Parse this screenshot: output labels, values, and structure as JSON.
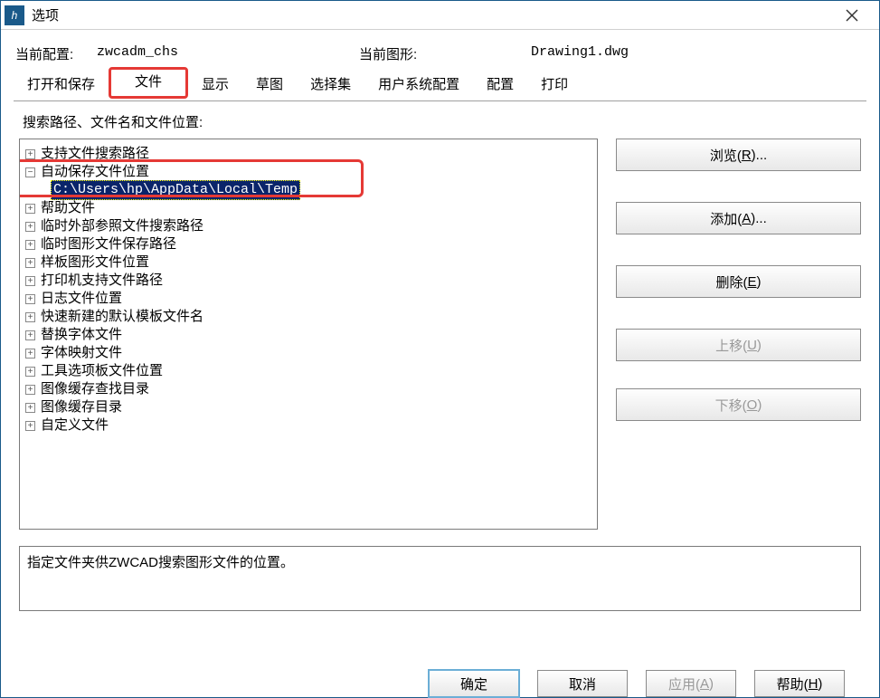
{
  "window_title": "选项",
  "config": {
    "profile_label": "当前配置:",
    "profile_value": "zwcadm_chs",
    "drawing_label": "当前图形:",
    "drawing_value": "Drawing1.dwg"
  },
  "tabs": [
    {
      "label": "打开和保存"
    },
    {
      "label": "文件",
      "active": true,
      "highlighted": true
    },
    {
      "label": "显示"
    },
    {
      "label": "草图"
    },
    {
      "label": "选择集"
    },
    {
      "label": "用户系统配置"
    },
    {
      "label": "配置"
    },
    {
      "label": "打印"
    }
  ],
  "section_heading": "搜索路径、文件名和文件位置:",
  "tree": {
    "items": [
      {
        "expander": "plus",
        "label": "支持文件搜索路径"
      },
      {
        "expander": "minus",
        "label": "自动保存文件位置",
        "highlighted": true
      },
      {
        "indent": true,
        "selected_path": "C:\\Users\\hp\\AppData\\Local\\Temp"
      },
      {
        "expander": "plus",
        "label": "帮助文件"
      },
      {
        "expander": "plus",
        "label": "临时外部参照文件搜索路径"
      },
      {
        "expander": "plus",
        "label": "临时图形文件保存路径"
      },
      {
        "expander": "plus",
        "label": "样板图形文件位置"
      },
      {
        "expander": "plus",
        "label": "打印机支持文件路径"
      },
      {
        "expander": "plus",
        "label": "日志文件位置"
      },
      {
        "expander": "plus",
        "label": "快速新建的默认模板文件名"
      },
      {
        "expander": "plus",
        "label": "替换字体文件"
      },
      {
        "expander": "plus",
        "label": "字体映射文件"
      },
      {
        "expander": "plus",
        "label": "工具选项板文件位置"
      },
      {
        "expander": "plus",
        "label": "图像缓存查找目录"
      },
      {
        "expander": "plus",
        "label": "图像缓存目录"
      },
      {
        "expander": "plus",
        "label": "自定义文件"
      }
    ]
  },
  "side_buttons": {
    "browse": {
      "label": "浏览(",
      "shortcut": "R",
      "suffix": ")..."
    },
    "add": {
      "label": "添加(",
      "shortcut": "A",
      "suffix": ")..."
    },
    "delete": {
      "label": "删除(",
      "shortcut": "E",
      "suffix": ")"
    },
    "move_up": {
      "label": "上移(",
      "shortcut": "U",
      "suffix": ")",
      "disabled": true
    },
    "move_down": {
      "label": "下移(",
      "shortcut": "O",
      "suffix": ")",
      "disabled": true
    }
  },
  "description": "指定文件夹供ZWCAD搜索图形文件的位置。",
  "bottom_buttons": {
    "ok": "确定",
    "cancel": "取消",
    "apply": {
      "label": "应用(",
      "shortcut": "A",
      "suffix": ")",
      "disabled": true
    },
    "help": {
      "label": "帮助(",
      "shortcut": "H",
      "suffix": ")"
    }
  }
}
